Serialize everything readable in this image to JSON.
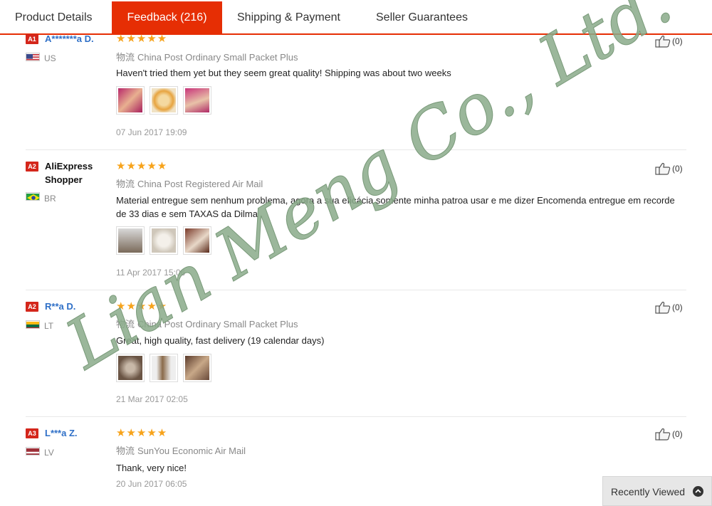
{
  "tabs": [
    {
      "label": "Product Details",
      "active": false
    },
    {
      "label": "Feedback (216)",
      "active": true
    },
    {
      "label": "Shipping & Payment",
      "active": false
    },
    {
      "label": "Seller Guarantees",
      "active": false
    }
  ],
  "accent_color": "#e62e04",
  "star_color": "#f7a31b",
  "reviews": [
    {
      "level": "A1",
      "buyer": "A*******a D.",
      "country": "US",
      "flag_icon": "us-flag-icon",
      "stars": "★★★★★",
      "rating": 5,
      "logistics_prefix": "物流",
      "logistics": "China Post Ordinary Small Packet Plus",
      "comment": "Haven't tried them yet but they seem great quality! Shipping was about two weeks",
      "photos": 3,
      "date": "07 Jun 2017 19:09",
      "likes": "(0)"
    },
    {
      "level": "A2",
      "buyer": "AliExpress Shopper",
      "country": "BR",
      "flag_icon": "br-flag-icon",
      "stars": "★★★★★",
      "rating": 5,
      "logistics_prefix": "物流",
      "logistics": "China Post Registered Air Mail",
      "comment": "Material entregue sem nenhum problema, agora a sua eficácia somente minha patroa usar e me dizer Encomenda entregue em recorde de 33 dias e sem TAXAS da Dilma",
      "photos": 3,
      "date": "11 Apr 2017 15:06",
      "likes": "(0)"
    },
    {
      "level": "A2",
      "buyer": "R**a D.",
      "country": "LT",
      "flag_icon": "lt-flag-icon",
      "stars": "★★★★★",
      "rating": 5,
      "logistics_prefix": "物流",
      "logistics": "China Post Ordinary Small Packet Plus",
      "comment": "Great, high quality, fast delivery (19 calendar days)",
      "photos": 3,
      "date": "21 Mar 2017 02:05",
      "likes": "(0)"
    },
    {
      "level": "A3",
      "buyer": "L***a Z.",
      "country": "LV",
      "flag_icon": "lv-flag-icon",
      "stars": "★★★★★",
      "rating": 5,
      "logistics_prefix": "物流",
      "logistics": "SunYou Economic Air Mail",
      "comment": "Thank, very nice!",
      "photos": 0,
      "date": "20 Jun 2017 06:05",
      "likes": "(0)"
    }
  ],
  "watermark": "Lian Meng Co., Ltd.",
  "recently_viewed": "Recently Viewed"
}
